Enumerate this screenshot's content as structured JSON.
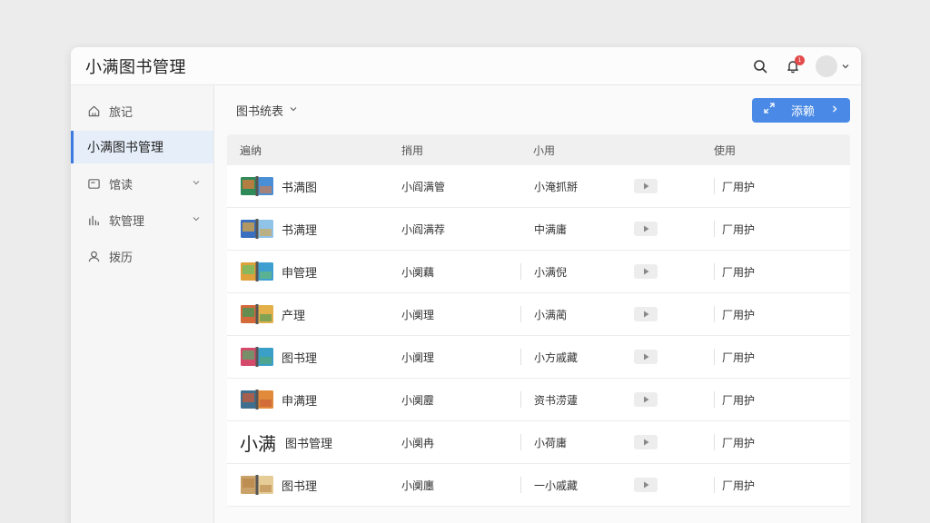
{
  "app": {
    "title": "小满图书管理"
  },
  "header": {
    "notifications_badge": "1",
    "icons": [
      "search-icon",
      "bell-icon",
      "avatar",
      "chevron-down-icon"
    ]
  },
  "sidebar": {
    "items": [
      {
        "label": "旅记",
        "icon": "home-icon",
        "active": false,
        "expandable": false
      },
      {
        "label": "小满图书管理",
        "icon": "",
        "active": true,
        "expandable": false
      },
      {
        "label": "馆读",
        "icon": "window-icon",
        "active": false,
        "expandable": true
      },
      {
        "label": "软管理",
        "icon": "bar-chart-icon",
        "active": false,
        "expandable": true
      },
      {
        "label": "拨历",
        "icon": "user-icon",
        "active": false,
        "expandable": false
      }
    ]
  },
  "toolbar": {
    "dropdown_label": "图书统表",
    "primary_button_label": "添赖"
  },
  "table": {
    "headers": [
      "遍纳",
      "捎用",
      "小用",
      "使用"
    ],
    "rows": [
      {
        "icon": "book-icon",
        "name": "书满图",
        "col2": "小阎满管",
        "col3": "小淹抓掰",
        "col4": "厂用护"
      },
      {
        "icon": "book-icon",
        "name": "书满理",
        "col2": "小阎满荐",
        "col3": "中满庸",
        "col4": "厂用护"
      },
      {
        "icon": "book-icon",
        "name": "申管理",
        "col2": "小阒藕",
        "col3": "小满倪",
        "col4": "厂用护"
      },
      {
        "icon": "book-icon",
        "name": "产理",
        "col2": "小阒理",
        "col3": "小满蔺",
        "col4": "厂用护"
      },
      {
        "icon": "book-icon",
        "name": "图书理",
        "col2": "小阒理",
        "col3": "小方戚藏",
        "col4": "厂用护"
      },
      {
        "icon": "book-icon",
        "name": "申满理",
        "col2": "小阒靂",
        "col3": "资书涝蘧",
        "col4": "厂用护"
      },
      {
        "icon": "brand-text",
        "brand": "小满",
        "name": "图书管理",
        "col2": "小阒冉",
        "col3": "小荷庸",
        "col4": "厂用护"
      },
      {
        "icon": "book-icon",
        "name": "图书理",
        "col2": "小阒廛",
        "col3": "一小戚藏",
        "col4": "厂用护"
      }
    ]
  },
  "colors": {
    "accent": "#4a8ae6",
    "active_bg": "#e6eef9",
    "badge": "#e34b4b"
  }
}
